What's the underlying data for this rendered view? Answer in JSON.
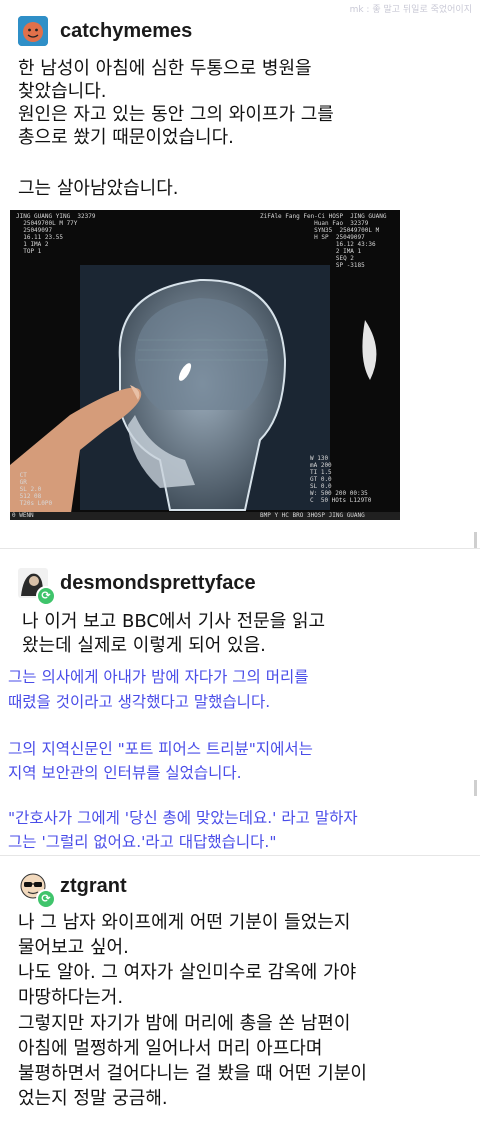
{
  "watermark": "mk : 좋 말고 뒤일로 죽었어이지",
  "post1": {
    "username": "catchymemes",
    "lines": [
      "한 남성이 아침에 심한 두통으로 병원을",
      "찾았습니다.",
      "원인은 자고 있는 동안 그의 와이프가 그를",
      "총으로 쐈기 때문이었습니다.",
      "",
      "그는 살아남았습니다."
    ],
    "image": {
      "top_left": "JING GUANG YING  32379\n  25049700L M 77Y\n  25049097\n  16.11 23.55\n  1 IMA 2\n  TOP 1",
      "top_right": "ZiFAle Fang Fen-Ci HOSP  JING GUANG\n               Huan Fao  32379\n               SYN35  25049700L M\n               H SP  25049097\n                     16.12 43:36\n                     2 IMA 1\n                     SEQ 2\n                     SP -3185",
      "bottom_left": " CT\n GR\n SL 2.0\n 512 08\n T20s L0P0",
      "bottom_right": "W 130\nmA 200\nTI 1.5\nGT 0.0\nSL 0.0\nW: 500 200 00:35\nC  50 HOts L129T0",
      "bottom_edge_left": "0 WENN",
      "bottom_edge_right": "BMP Y HC BRO 3HOSP JING GUANG"
    }
  },
  "post2": {
    "username": "desmondsprettyface",
    "lines": [
      "나 이거 보고 BBC에서 기사 전문을 읽고",
      "왔는데 실제로 이렇게 되어 있음."
    ],
    "quote": [
      "그는 의사에게 아내가 밤에 자다가 그의 머리를",
      "때렸을 것이라고 생각했다고 말했습니다.",
      "",
      "그의 지역신문인 \"포트 피어스 트리뷴\"지에서는",
      "지역 보안관의 인터뷰를 실었습니다.",
      "",
      "\"간호사가 그에게 '당신 총에 맞았는데요.' 라고 말하자",
      "그는 '그럴리 없어요.'라고 대답했습니다.\""
    ]
  },
  "post3": {
    "username": "ztgrant",
    "lines": [
      "나 그 남자 와이프에게 어떤 기분이 들었는지",
      "물어보고 싶어.",
      "나도 알아. 그 여자가 살인미수로 감옥에 가야",
      "마땅하다는거.",
      "그렇지만 자기가 밤에 머리에 총을 쏜 남편이",
      "아침에 멀쩡하게 일어나서 머리 아프다며",
      "불평하면서 걸어다니는 걸 봤을 때 어떤 기분이",
      "었는지 정말 궁금해."
    ]
  },
  "colors": {
    "quote_text": "#4a4de8",
    "reblog_badge": "#3fc46b",
    "avatar1": "#e0704a"
  },
  "icons": {
    "reblog": "reblog-icon",
    "avatar1": "avatar-orange-face",
    "avatar2": "avatar-photo",
    "avatar3": "avatar-sunglasses-face"
  }
}
